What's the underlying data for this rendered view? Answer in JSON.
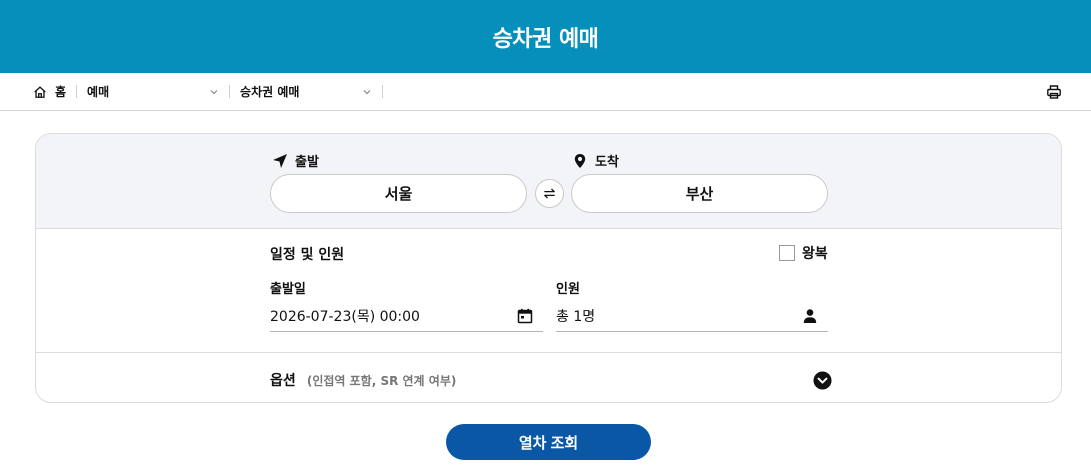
{
  "header": {
    "title": "승차권 예매"
  },
  "breadcrumb": {
    "home_label": "홈",
    "level1": "예매",
    "level2": "승차권 예매"
  },
  "route": {
    "departure_label": "출발",
    "arrival_label": "도착",
    "departure_station": "서울",
    "arrival_station": "부산"
  },
  "schedule": {
    "title": "일정 및 인원",
    "roundtrip_label": "왕복",
    "roundtrip_checked": false,
    "date_label": "출발일",
    "date_value": "2026-07-23(목) 00:00",
    "passenger_label": "인원",
    "passenger_value": "총 1명"
  },
  "options": {
    "label": "옵션",
    "sublabel": "(인접역 포함, SR 연계 여부)"
  },
  "search_button": "열차 조회",
  "colors": {
    "header_bg": "#078fbb",
    "primary_button": "#0a57a6",
    "route_bg": "#f3f4f7"
  },
  "icons": {
    "home": "home-icon",
    "chevron": "chevron-down-icon",
    "print": "printer-icon",
    "departure": "navigation-arrow-icon",
    "arrival": "map-pin-icon",
    "swap": "swap-icon",
    "calendar": "calendar-icon",
    "person": "person-icon",
    "option_toggle": "chevron-circle-down-icon"
  }
}
